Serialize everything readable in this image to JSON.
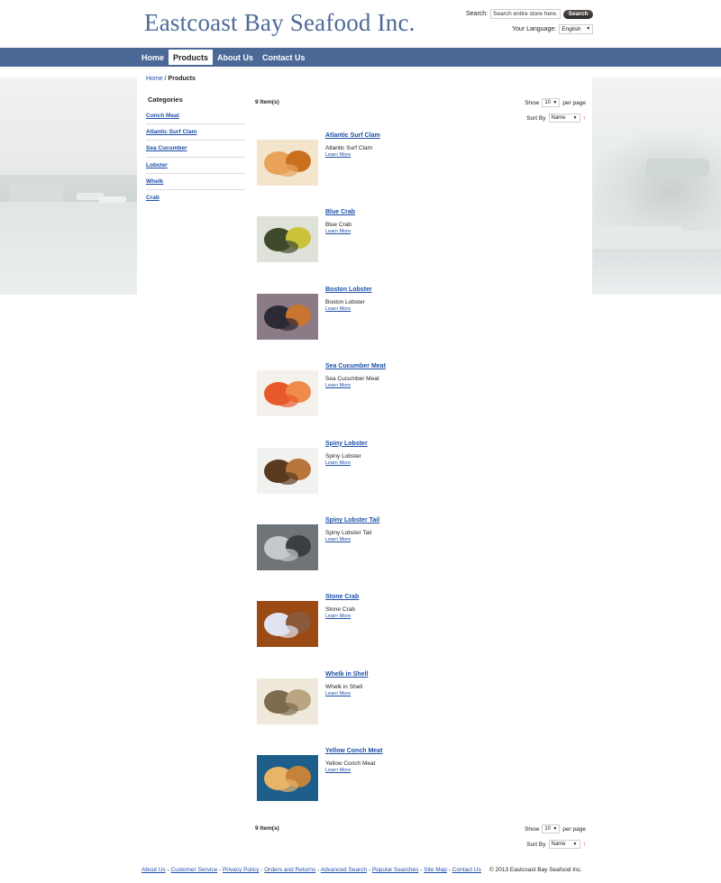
{
  "header": {
    "logo": "Eastcoast Bay Seafood Inc.",
    "search_label": "Search:",
    "search_placeholder": "Search entire store here...",
    "search_button": "Search",
    "language_label": "Your Language:",
    "language_value": "English"
  },
  "nav": {
    "items": [
      {
        "label": "Home",
        "active": false
      },
      {
        "label": "Products",
        "active": true
      },
      {
        "label": "About Us",
        "active": false
      },
      {
        "label": "Contact Us",
        "active": false
      }
    ]
  },
  "breadcrumb": {
    "home": "Home",
    "separator": "/",
    "current": "Products"
  },
  "sidebar": {
    "title": "Categories",
    "items": [
      "Conch Meat",
      "Atlantic Surf Clam",
      "Sea Cucumber",
      "Lobster",
      "Whelk",
      "Crab"
    ]
  },
  "toolbar": {
    "count": "9 Item(s)",
    "show_label": "Show",
    "show_value": "10",
    "per_page": "per page",
    "sort_label": "Sort By",
    "sort_value": "Name",
    "sort_arrow": "↑"
  },
  "products": [
    {
      "name": "Atlantic Surf Clam",
      "desc": "Atlantic Surf Clam",
      "more": "Learn More",
      "palette": [
        "#f3e4cc",
        "#e8a25a",
        "#c9701f"
      ]
    },
    {
      "name": "Blue Crab",
      "desc": "Blue Crab",
      "more": "Learn More",
      "palette": [
        "#dfe2d8",
        "#3f4a2c",
        "#c9c23a"
      ]
    },
    {
      "name": "Boston Lobster",
      "desc": "Boston Lobster",
      "more": "Learn More",
      "palette": [
        "#8a7b86",
        "#2c2a34",
        "#c9742f"
      ]
    },
    {
      "name": "Sea Cucumber Meat",
      "desc": "Sea Cucumber Meat",
      "more": "Learn More",
      "palette": [
        "#f4f0ec",
        "#e8592a",
        "#f08a4a"
      ]
    },
    {
      "name": "Spiny Lobster",
      "desc": "Spiny Lobster",
      "more": "Learn More",
      "palette": [
        "#f1f1ef",
        "#5a3a1f",
        "#b9763a"
      ]
    },
    {
      "name": "Spiny Lobster Tail",
      "desc": "Spiny Lobster Tail",
      "more": "Learn More",
      "palette": [
        "#6f7478",
        "#c5c9cc",
        "#3b3f43"
      ]
    },
    {
      "name": "Stone Crab",
      "desc": "Stone Crab",
      "more": "Learn More",
      "palette": [
        "#9a4a12",
        "#dfe4f0",
        "#8a5a3a"
      ]
    },
    {
      "name": "Whelk in Shell",
      "desc": "Whelk in Shell",
      "more": "Learn More",
      "palette": [
        "#efe9dc",
        "#7e6a4c",
        "#b9a582"
      ]
    },
    {
      "name": "Yellow Conch Meat",
      "desc": "Yellow Conch Meat",
      "more": "Learn More",
      "palette": [
        "#1d5f8a",
        "#e8b468",
        "#c4823a"
      ]
    }
  ],
  "footer": {
    "links": [
      "About Us",
      "Customer Service",
      "Privacy Policy",
      "Orders and Returns",
      "Advanced Search",
      "Popular Searches",
      "Site Map",
      "Contact Us"
    ],
    "separator": " - ",
    "copyright": "© 2013 Eastcoast Bay Seafood Inc."
  },
  "colors": {
    "nav_bg": "#4c6896",
    "logo": "#4f6a97",
    "link": "#1c4fa8"
  }
}
